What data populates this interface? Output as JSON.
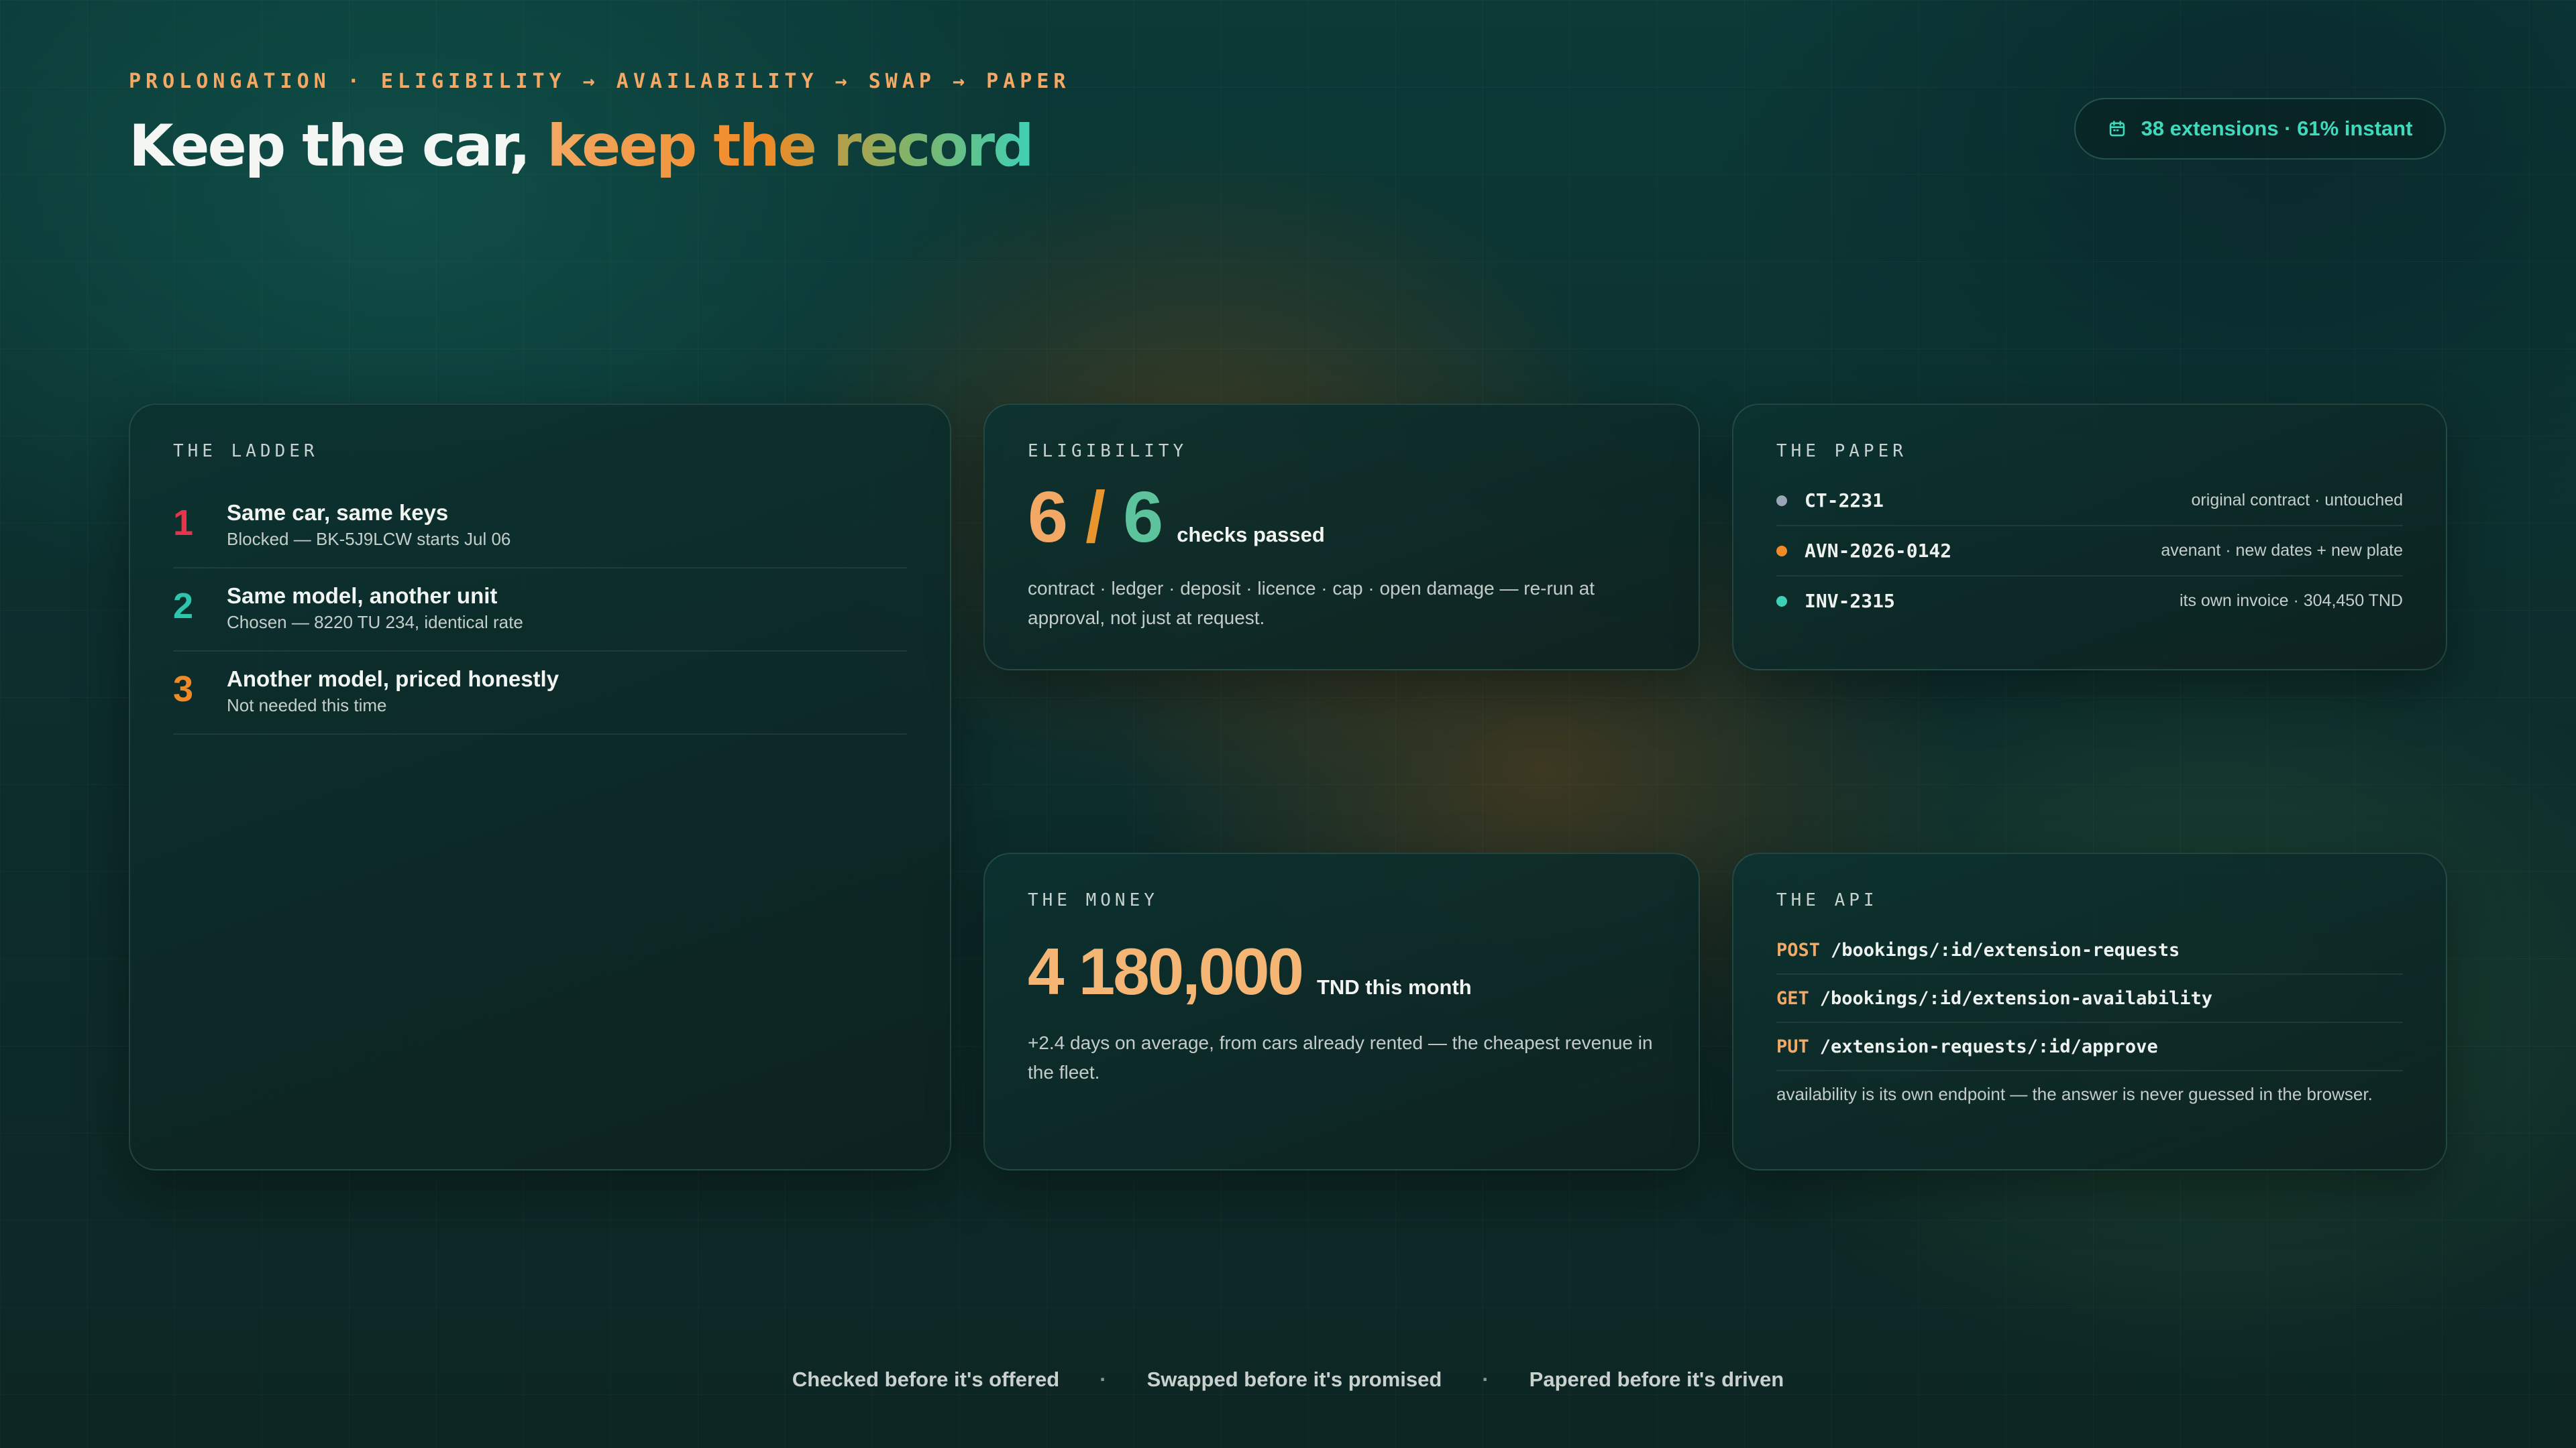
{
  "header": {
    "kicker": "PROLONGATION · ELIGIBILITY → AVAILABILITY → SWAP → PAPER",
    "title_plain": "Keep the car, ",
    "title_accent": "keep the record",
    "pill_text": "38 extensions · 61% instant",
    "pill_icon": "calendar-icon"
  },
  "colors": {
    "orange": "#f3a965",
    "deep_orange": "#ef8a26",
    "teal": "#3fd1b5",
    "red": "#e8334a",
    "slate": "#9aa6b8"
  },
  "ladder": {
    "label": "THE LADDER",
    "rungs": [
      {
        "num": "1",
        "title": "Same car, same keys",
        "sub": "Blocked — BK-5J9LCW starts Jul 06"
      },
      {
        "num": "2",
        "title": "Same model, another unit",
        "sub": "Chosen — 8220 TU 234, identical rate"
      },
      {
        "num": "3",
        "title": "Another model, priced honestly",
        "sub": "Not needed this time"
      }
    ]
  },
  "eligibility": {
    "label": "ELIGIBILITY",
    "passed": "6",
    "slash": " / ",
    "total": "6",
    "unit": "checks passed",
    "desc": "contract · ledger · deposit · licence · cap · open damage — re-run at approval, not just at request."
  },
  "paper": {
    "label": "THE PAPER",
    "rows": [
      {
        "code": "CT-2231",
        "note": "original contract · untouched"
      },
      {
        "code": "AVN-2026-0142",
        "note": "avenant · new dates + new plate"
      },
      {
        "code": "INV-2315",
        "note": "its own invoice · 304,450 TND"
      }
    ]
  },
  "money": {
    "label": "THE MONEY",
    "amount": "4 180,000",
    "unit": "TND this month",
    "desc": "+2.4 days on average, from cars already rented — the cheapest revenue in the fleet."
  },
  "api": {
    "label": "THE API",
    "rows": [
      {
        "method": "POST",
        "path": "/bookings/:id/extension-requests"
      },
      {
        "method": "GET",
        "path": "/bookings/:id/extension-availability"
      },
      {
        "method": "PUT",
        "path": "/extension-requests/:id/approve"
      }
    ],
    "note": "availability is its own endpoint — the answer is never guessed in the browser."
  },
  "footer": {
    "items": [
      "Checked before it's offered",
      "Swapped before it's promised",
      "Papered before it's driven"
    ],
    "separator": "·"
  }
}
